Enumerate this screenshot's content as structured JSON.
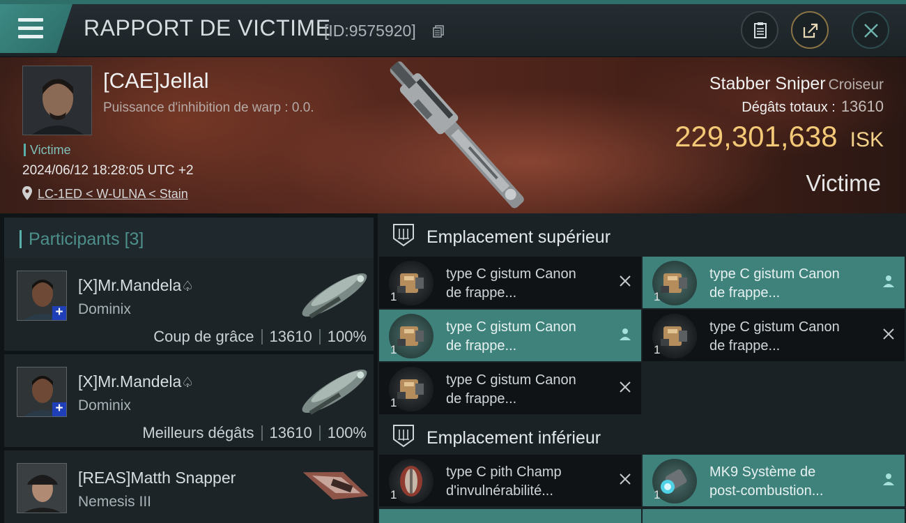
{
  "header": {
    "title": "RAPPORT DE VICTIME",
    "report_id": "[ID:9575920]",
    "icons": [
      "menu-icon",
      "copy-icon",
      "clipboard-icon",
      "share-icon",
      "close-icon"
    ]
  },
  "victim": {
    "name": "[CAE]Jellal",
    "warp": "Puissance d'inhibition de warp : 0.0.",
    "role": "Victime",
    "datetime": "2024/06/12 18:28:05 UTC +2",
    "location": "LC-1ED < W-ULNA < Stain",
    "ship_name": "Stabber Sniper",
    "ship_class": "Croiseur",
    "damage_label": "Dégâts totaux :",
    "damage_value": "13610",
    "isk_value": "229,301,638",
    "isk_currency": "ISK",
    "status": "Victime"
  },
  "participants": {
    "title": "Participants",
    "count": "[3]",
    "items": [
      {
        "name": "[X]Mr.Mandela",
        "ship": "Dominix",
        "tag": "Coup de grâce",
        "damage": "13610",
        "percent": "100%"
      },
      {
        "name": "[X]Mr.Mandela",
        "ship": "Dominix",
        "tag": "Meilleurs dégâts",
        "damage": "13610",
        "percent": "100%"
      },
      {
        "name": "[REAS]Matth Snapper",
        "ship": "Nemesis III"
      }
    ]
  },
  "slots": {
    "upper": {
      "title": "Emplacement supérieur",
      "modules": [
        {
          "line1": "type C gistum Canon",
          "line2": "de frappe...",
          "qty": "1",
          "state": "destroyed"
        },
        {
          "line1": "type C gistum Canon",
          "line2": "de frappe...",
          "qty": "1",
          "state": "dropped"
        },
        {
          "line1": "type C gistum Canon",
          "line2": "de frappe...",
          "qty": "1",
          "state": "dropped"
        },
        {
          "line1": "type C gistum Canon",
          "line2": "de frappe...",
          "qty": "1",
          "state": "destroyed"
        },
        {
          "line1": "type C gistum Canon",
          "line2": "de frappe...",
          "qty": "1",
          "state": "destroyed"
        }
      ]
    },
    "lower": {
      "title": "Emplacement inférieur",
      "modules": [
        {
          "line1": "type C pith Champ",
          "line2": "d'invulnérabilité...",
          "qty": "1",
          "state": "destroyed"
        },
        {
          "line1": "MK9 Système de",
          "line2": "post-combustion...",
          "qty": "1",
          "state": "dropped"
        }
      ]
    }
  },
  "colors": {
    "accent": "#3f827c",
    "isk": "#f3c977",
    "panel": "#1b2226"
  }
}
